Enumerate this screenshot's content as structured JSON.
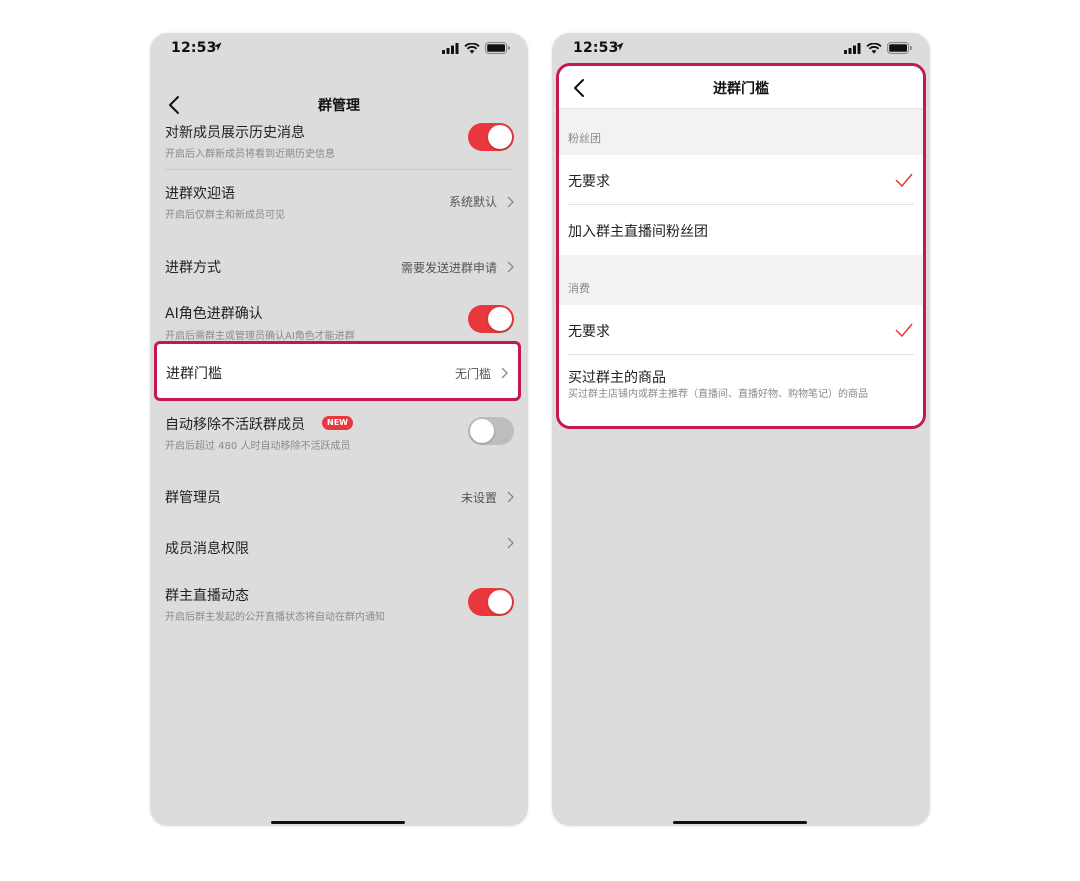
{
  "left": {
    "status": {
      "time": "12:53"
    },
    "nav": {
      "title": "群管理"
    },
    "rows": [
      {
        "title": "对新成员展示历史消息",
        "subtitle": "开启后入群新成员将看到近期历史信息",
        "toggle": "on"
      },
      {
        "title": "进群欢迎语",
        "subtitle": "开启后仅群主和新成员可见",
        "value": "系统默认"
      },
      {
        "title": "进群方式",
        "value": "需要发送进群申请"
      },
      {
        "title": "AI角色进群确认",
        "subtitle": "开启后需群主或管理员确认AI角色才能进群",
        "toggle": "on"
      },
      {
        "title": "进群门槛",
        "value": "无门槛"
      },
      {
        "title": "自动移除不活跃群成员",
        "badge": "NEW",
        "subtitle": "开启后超过 480 人时自动移除不活跃成员",
        "toggle": "off"
      },
      {
        "title": "群管理员",
        "value": "未设置"
      },
      {
        "title": "成员消息权限"
      },
      {
        "title": "群主直播动态",
        "subtitle": "开启后群主发起的公开直播状态将自动在群内通知",
        "toggle": "on"
      }
    ]
  },
  "right": {
    "status": {
      "time": "12:53"
    },
    "nav": {
      "title": "进群门槛"
    },
    "sections": [
      {
        "label": "粉丝团",
        "options": [
          {
            "label": "无要求",
            "selected": true
          },
          {
            "label": "加入群主直播间粉丝团",
            "selected": false
          }
        ]
      },
      {
        "label": "消费",
        "options": [
          {
            "label": "无要求",
            "selected": true
          },
          {
            "label": "买过群主的商品",
            "desc": "买过群主店铺内或群主推荐（直播间、直播好物、购物笔记）的商品",
            "selected": false
          }
        ]
      }
    ]
  },
  "colors": {
    "accent": "#e8383d",
    "highlight_border": "#c41a4b",
    "background": "#dcdcdc"
  },
  "icons": [
    "location-arrow-icon",
    "signal-icon",
    "wifi-icon",
    "battery-icon",
    "back-arrow-icon",
    "chevron-right-icon",
    "checkmark-icon"
  ]
}
